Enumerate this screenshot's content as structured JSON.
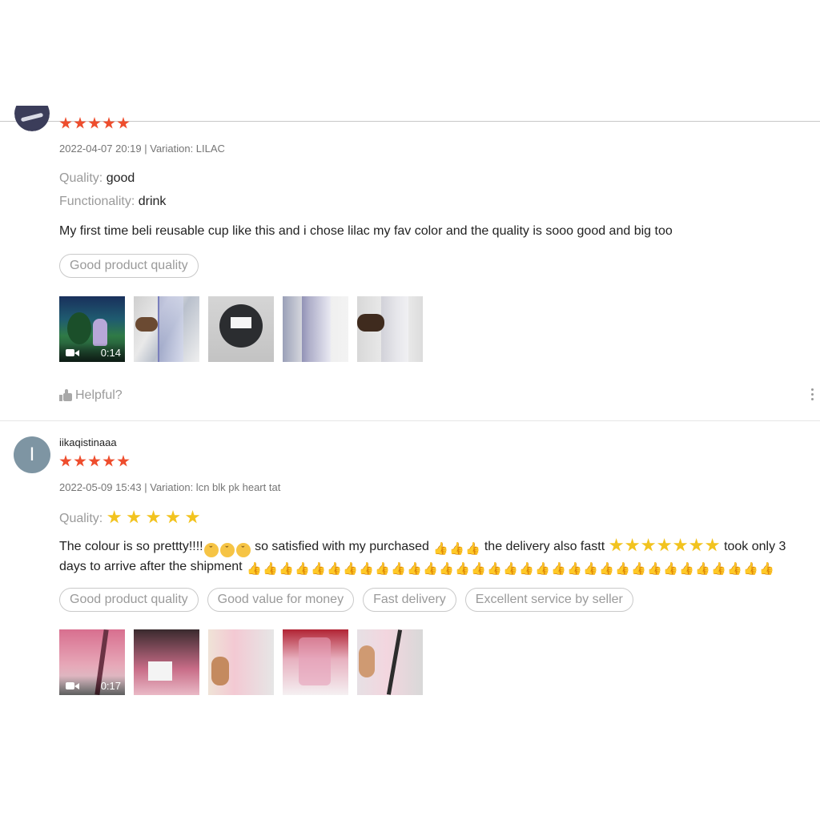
{
  "reviews": [
    {
      "username": "",
      "rating": 5,
      "meta": "2022-04-07 20:19 | Variation: LILAC",
      "attributes": [
        {
          "label": "Quality:",
          "value": "good"
        },
        {
          "label": "Functionality:",
          "value": "drink"
        }
      ],
      "text": "My first time beli reusable cup like this and i chose lilac my fav color and the quality is sooo good and big too",
      "tags": [
        "Good product quality"
      ],
      "video_duration": "0:14",
      "media_count": 5,
      "helpful_label": "Helpful?"
    },
    {
      "avatar_letter": "I",
      "username": "iikaqistinaaa",
      "rating": 5,
      "meta": "2022-05-09 15:43 | Variation: lcn blk pk heart tat",
      "quality_label": "Quality:",
      "quality_stars": 5,
      "text_segments": [
        "The colour is so prettty!!!!",
        "so satisfied with my purchased",
        "the delivery also fastt",
        "took only 3 days to arrive after the shipment"
      ],
      "tags": [
        "Good product quality",
        "Good value for money",
        "Fast delivery",
        "Excellent service by seller"
      ],
      "video_duration": "0:17",
      "media_count": 5
    }
  ],
  "colors": {
    "rating_star": "#ee4d2d",
    "muted_text": "#9a9a9a",
    "meta_text": "#757575",
    "tag_border": "#c9c9c9",
    "avatar_bg": "#7e95a3"
  },
  "icons": {
    "rating": "star-icon",
    "video": "video-camera-icon",
    "helpful": "thumbs-up-icon",
    "more": "more-vertical-icon",
    "emoji_thumb": "thumbs-up-emoji",
    "emoji_star": "star-emoji",
    "emoji_cry": "crying-face-emoji"
  }
}
